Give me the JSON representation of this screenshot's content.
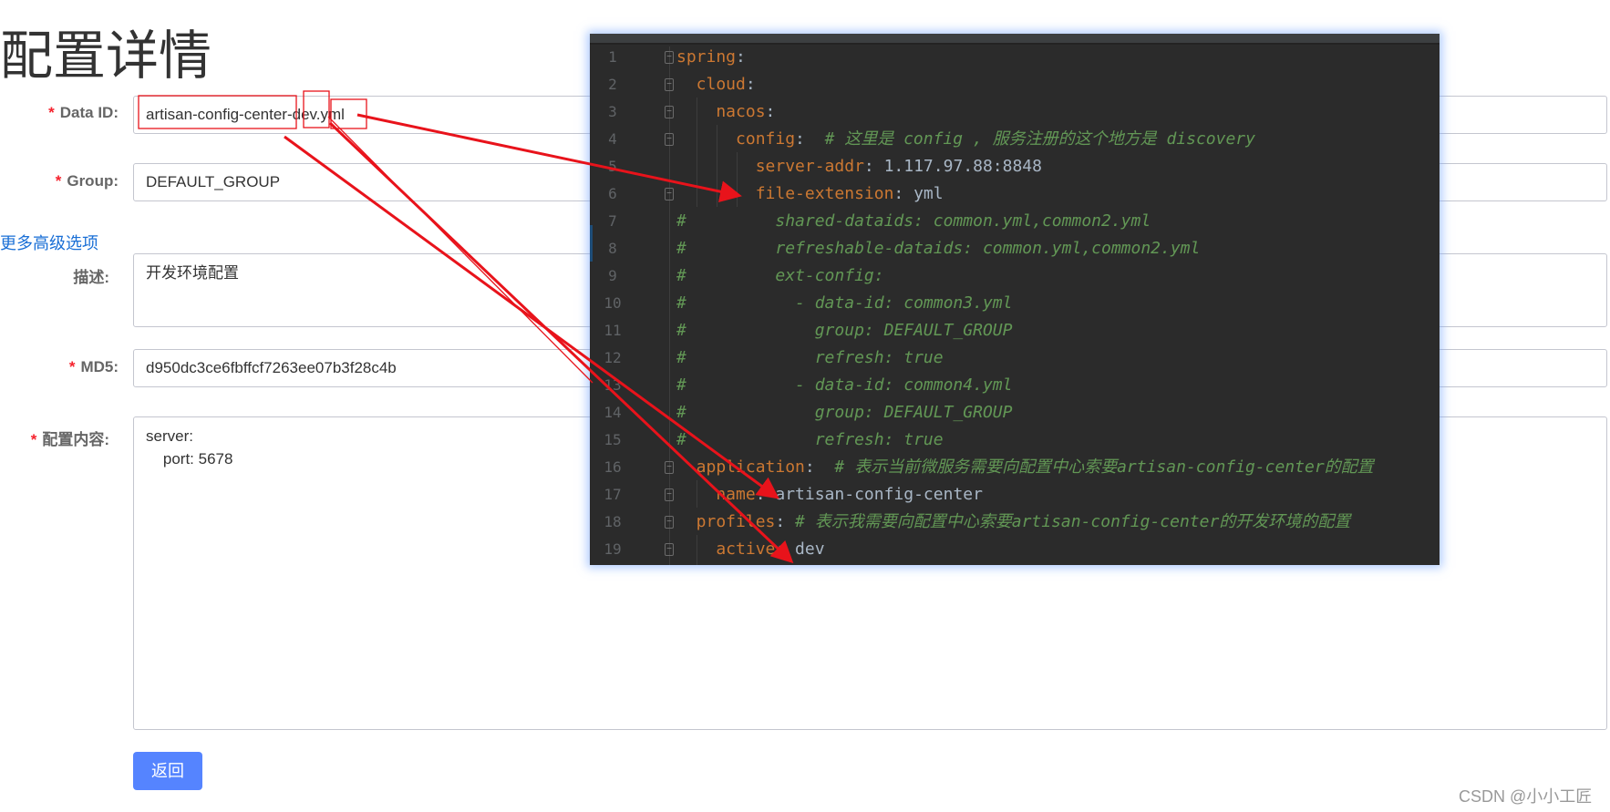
{
  "page": {
    "title": "配置详情"
  },
  "form": {
    "required_mark": "*",
    "data_id": {
      "label": "Data ID:",
      "value": "artisan-config-center-dev.yml"
    },
    "group": {
      "label": "Group:",
      "value": "DEFAULT_GROUP"
    },
    "advanced_link": "更多高级选项",
    "description": {
      "label": "描述:",
      "value": "开发环境配置"
    },
    "md5": {
      "label": "MD5:",
      "value": "d950dc3ce6fbffcf7263ee07b3f28c4b"
    },
    "content": {
      "label": "配置内容:",
      "value": "server:\n    port: 5678"
    },
    "back_button": "返回"
  },
  "watermark": "CSDN @小小工匠",
  "annotation_color": "#e8131b",
  "editor": {
    "colors": {
      "background": "#2b2b2b",
      "key": "#cc7832",
      "value": "#a9b7c6",
      "comment": "#629755",
      "line_number": "#606366"
    },
    "lines": [
      {
        "n": "1",
        "fold": "open",
        "segs": [
          {
            "t": "spring",
            "c": "k"
          },
          {
            "t": ":",
            "c": "v"
          }
        ]
      },
      {
        "n": "2",
        "fold": "open",
        "segs": [
          {
            "t": "  cloud",
            "c": "k"
          },
          {
            "t": ":",
            "c": "v"
          }
        ]
      },
      {
        "n": "3",
        "fold": "open",
        "segs": [
          {
            "t": "    nacos",
            "c": "k"
          },
          {
            "t": ":",
            "c": "v"
          }
        ]
      },
      {
        "n": "4",
        "fold": "open",
        "segs": [
          {
            "t": "      config",
            "c": "k"
          },
          {
            "t": ":",
            "c": "v"
          },
          {
            "t": "  # 这里是 config , 服务注册的这个地方是 discovery",
            "c": "c"
          }
        ]
      },
      {
        "n": "5",
        "segs": [
          {
            "t": "        server-addr",
            "c": "k"
          },
          {
            "t": ": 1.117.97.88:8848",
            "c": "v"
          }
        ]
      },
      {
        "n": "6",
        "fold": "close",
        "segs": [
          {
            "t": "        file-extension",
            "c": "k"
          },
          {
            "t": ": yml",
            "c": "v"
          }
        ]
      },
      {
        "n": "7",
        "segs": [
          {
            "t": "#         shared-dataids: common.yml,common2.yml",
            "c": "c"
          }
        ]
      },
      {
        "n": "8",
        "segs": [
          {
            "t": "#         refreshable-dataids: common.yml,common2.yml",
            "c": "c"
          }
        ]
      },
      {
        "n": "9",
        "segs": [
          {
            "t": "#         ext-config:",
            "c": "c"
          }
        ]
      },
      {
        "n": "10",
        "segs": [
          {
            "t": "#           - data-id: common3.yml",
            "c": "c"
          }
        ]
      },
      {
        "n": "11",
        "segs": [
          {
            "t": "#             group: DEFAULT_GROUP",
            "c": "c"
          }
        ]
      },
      {
        "n": "12",
        "segs": [
          {
            "t": "#             refresh: true",
            "c": "c"
          }
        ]
      },
      {
        "n": "13",
        "segs": [
          {
            "t": "#           - data-id: common4.yml",
            "c": "c"
          }
        ]
      },
      {
        "n": "14",
        "segs": [
          {
            "t": "#             group: DEFAULT_GROUP",
            "c": "c"
          }
        ]
      },
      {
        "n": "15",
        "segs": [
          {
            "t": "#             refresh: true",
            "c": "c"
          }
        ]
      },
      {
        "n": "16",
        "fold": "open",
        "segs": [
          {
            "t": "  application",
            "c": "k"
          },
          {
            "t": ":",
            "c": "v"
          },
          {
            "t": "  # 表示当前微服务需要向配置中心索要artisan-config-center的配置",
            "c": "c"
          }
        ]
      },
      {
        "n": "17",
        "fold": "close",
        "segs": [
          {
            "t": "    name",
            "c": "k"
          },
          {
            "t": ": artisan-config-center",
            "c": "v"
          }
        ]
      },
      {
        "n": "18",
        "fold": "open",
        "segs": [
          {
            "t": "  profiles",
            "c": "k"
          },
          {
            "t": ":",
            "c": "v"
          },
          {
            "t": " # 表示我需要向配置中心索要artisan-config-center的开发环境的配置",
            "c": "c"
          }
        ]
      },
      {
        "n": "19",
        "fold": "close",
        "segs": [
          {
            "t": "    active",
            "c": "k"
          },
          {
            "t": ": dev",
            "c": "v"
          }
        ]
      }
    ]
  }
}
